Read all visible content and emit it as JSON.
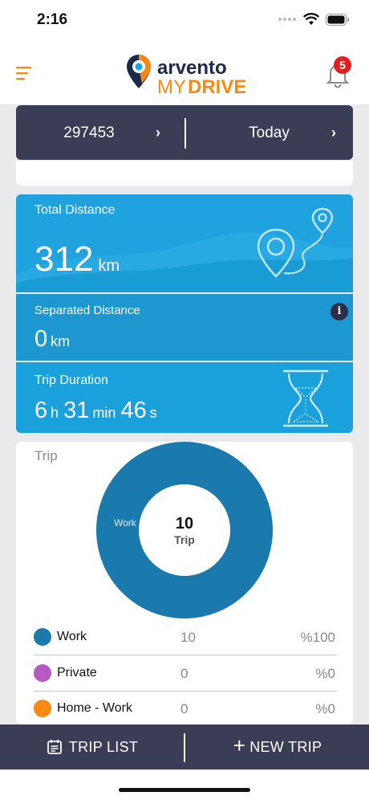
{
  "status_bar": {
    "time": "2:16"
  },
  "header": {
    "logo_top": "arvento",
    "logo_bottom_left": "MY",
    "logo_bottom_right": "DRIVE",
    "notification_count": "5"
  },
  "selector": {
    "vehicle": "297453",
    "period": "Today",
    "vehicle_chevron": "›",
    "period_chevron": "›"
  },
  "stats": {
    "total_distance": {
      "label": "Total Distance",
      "value": "312",
      "unit": "km"
    },
    "separated_distance": {
      "label": "Separated Distance",
      "value": "0",
      "unit": "km",
      "info_icon": "i"
    },
    "trip_duration": {
      "label": "Trip Duration",
      "hours": "6",
      "hours_unit": "h",
      "minutes": "31",
      "minutes_unit": "min",
      "seconds": "46",
      "seconds_unit": "s"
    }
  },
  "trip_card": {
    "title": "Trip",
    "center_value": "10",
    "center_label": "Trip",
    "slice_label": "Work"
  },
  "chart_data": {
    "type": "pie",
    "title": "Trip",
    "categories": [
      "Work",
      "Private",
      "Home - Work"
    ],
    "values": [
      10,
      0,
      0
    ],
    "percentages": [
      "%100",
      "%0",
      "%0"
    ],
    "colors": [
      "#1b7aad",
      "#b45ac2",
      "#f68a12"
    ],
    "total": 10,
    "legend": "bottom"
  },
  "legend": [
    {
      "name": "Work",
      "count": "10",
      "percent": "%100",
      "color": "#1b7aad"
    },
    {
      "name": "Private",
      "count": "0",
      "percent": "%0",
      "color": "#b45ac2"
    },
    {
      "name": "Home - Work",
      "count": "0",
      "percent": "%0",
      "color": "#f68a12"
    }
  ],
  "bottom_bar": {
    "trip_list_label": "TRIP LIST",
    "new_trip_label": "NEW TRIP",
    "plus": "+"
  },
  "colors": {
    "accent_orange": "#f68a12",
    "navy": "#3a3d55",
    "panel_blue": "#1fa2dd",
    "chart_blue": "#1b7aad",
    "badge_red": "#e02020"
  }
}
